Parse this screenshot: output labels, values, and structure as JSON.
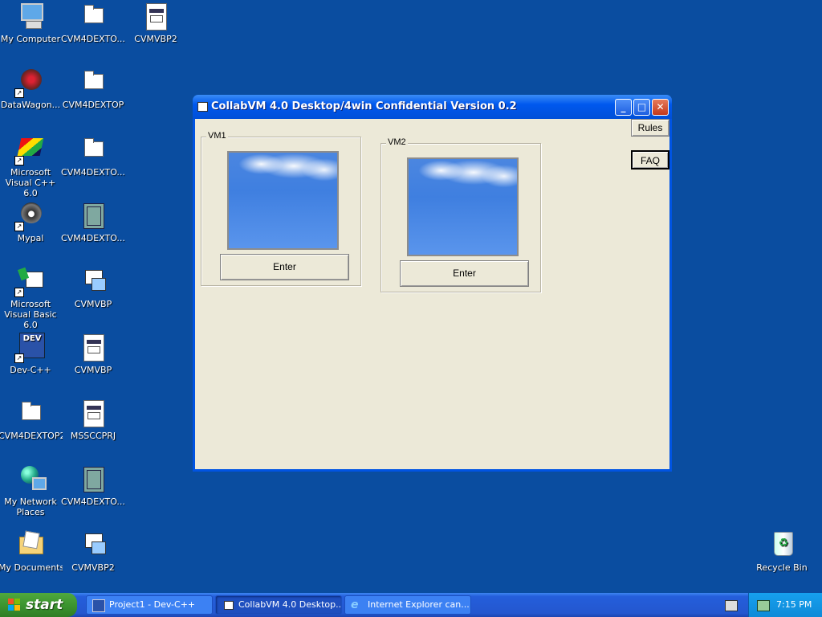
{
  "desktop": {
    "icons_col1": [
      {
        "label": "My Computer"
      },
      {
        "label": "DataWagon..."
      },
      {
        "label": "Microsoft Visual C++ 6.0"
      },
      {
        "label": "Mypal"
      },
      {
        "label": "Microsoft Visual Basic 6.0"
      },
      {
        "label": "Dev-C++"
      },
      {
        "label": "CVM4DEXTOP2"
      },
      {
        "label": "My Network Places"
      },
      {
        "label": "My Documents"
      }
    ],
    "icons_col2": [
      {
        "label": "CVM4DEXTO..."
      },
      {
        "label": "CVM4DEXTOP"
      },
      {
        "label": "CVM4DEXTO..."
      },
      {
        "label": "CVM4DEXTO..."
      },
      {
        "label": "CVMVBP"
      },
      {
        "label": "CVMVBP"
      },
      {
        "label": "MSSCCPRJ"
      },
      {
        "label": "CVM4DEXTO..."
      },
      {
        "label": "CVMVBP2"
      }
    ],
    "icon_col3": {
      "label": "CVMVBP2"
    },
    "recycle_bin": {
      "label": "Recycle Bin"
    }
  },
  "window": {
    "title": "CollabVM 4.0 Desktop/4win Confidential Version 0.2",
    "rules_label": "Rules",
    "faq_label": "FAQ",
    "vm1": {
      "label": "VM1",
      "enter_label": "Enter"
    },
    "vm2": {
      "label": "VM2",
      "enter_label": "Enter"
    }
  },
  "taskbar": {
    "start_label": "start",
    "tasks": [
      {
        "label": "Project1 - Dev-C++"
      },
      {
        "label": "CollabVM 4.0 Desktop..."
      },
      {
        "label": "Internet Explorer can..."
      }
    ],
    "clock": "7:15 PM"
  },
  "colors": {
    "desktop_bg": "#0a4da0",
    "titlebar": "#0058ee",
    "client_bg": "#ece9d8"
  }
}
